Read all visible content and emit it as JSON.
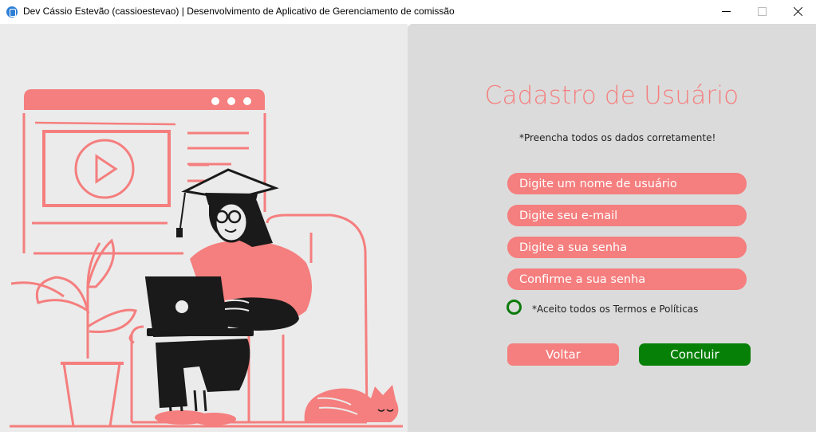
{
  "window": {
    "title": "Dev Cássio Estevão (cassioestevao) | Desenvolvimento de Aplicativo de Gerenciamento de comissão"
  },
  "form": {
    "title": "Cadastro de Usuário",
    "hint": "*Preencha todos os dados corretamente!",
    "fields": {
      "username_placeholder": "Digite um nome de usuário",
      "email_placeholder": "Digite seu e-mail",
      "password_placeholder": "Digite a sua senha",
      "confirm_placeholder": "Confirme a sua senha"
    },
    "terms_label": "*Aceito todos os Termos e Políticas",
    "back_label": "Voltar",
    "submit_label": "Concluir"
  },
  "colors": {
    "accent": "#f57e7e",
    "success": "#078007",
    "panel_left": "#ebebeb",
    "panel_right": "#dbdbdb"
  },
  "icons": [
    "app-icon",
    "minimize-icon",
    "maximize-icon",
    "close-icon",
    "play-icon"
  ]
}
